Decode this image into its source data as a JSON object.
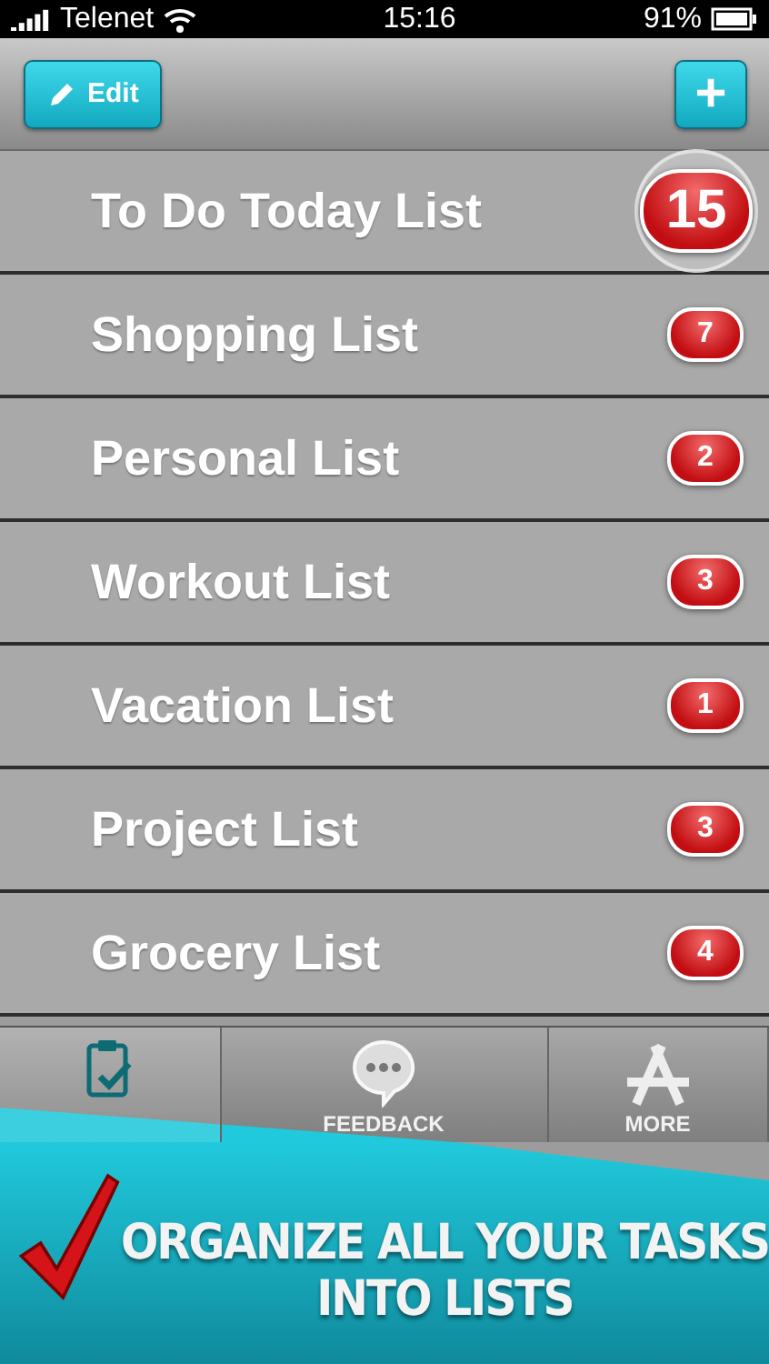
{
  "status_bar": {
    "carrier": "Telenet",
    "time": "15:16",
    "battery": "91%"
  },
  "nav_bar": {
    "edit_button": "Edit",
    "add_button": "+"
  },
  "lists": [
    {
      "name": "To Do Today List",
      "count": "15",
      "magnified": true
    },
    {
      "name": "Shopping List",
      "count": "7",
      "magnified": false
    },
    {
      "name": "Personal List",
      "count": "2",
      "magnified": false
    },
    {
      "name": "Workout List",
      "count": "3",
      "magnified": false
    },
    {
      "name": "Vacation List",
      "count": "1",
      "magnified": false
    },
    {
      "name": "Project List",
      "count": "3",
      "magnified": false
    },
    {
      "name": "Grocery List",
      "count": "4",
      "magnified": false
    }
  ],
  "tab_bar": [
    {
      "kind": "lists",
      "selected": true
    },
    {
      "kind": "feedback",
      "label": "FEEDBACK",
      "selected": false
    },
    {
      "kind": "more",
      "label": "MORE",
      "selected": false
    }
  ],
  "banner": {
    "lines": [
      "ORGANIZE ALL YOUR TASKS",
      "INTO LISTS"
    ]
  }
}
